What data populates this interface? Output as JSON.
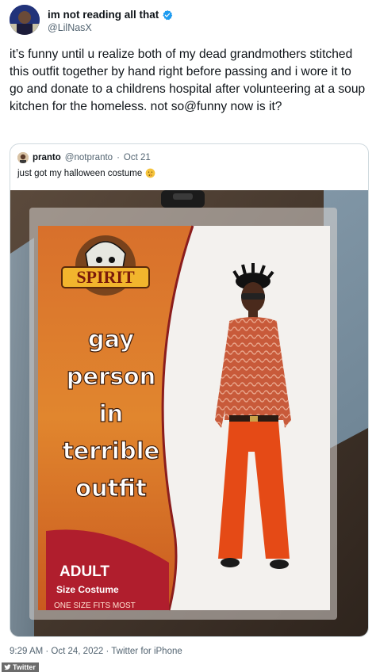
{
  "tweet": {
    "display_name": "im not reading all that",
    "handle": "@LilNasX",
    "text": "it’s funny until u realize both of my dead grandmothers stitched this outfit together by hand right before passing and i wore it to go and donate to a childrens hospital after volunteering at a soup kitchen for the homeless. not so@funny now is it?",
    "footer": "9:29 AM · Oct 24, 2022 · Twitter for iPhone",
    "verified_color": "#1d9bf0"
  },
  "quote": {
    "display_name": "pranto",
    "handle": "@notpranto",
    "separator": "·",
    "date": "Oct 21",
    "text": "just got my halloween costume",
    "emoji": "shushing-face-emoji"
  },
  "package": {
    "logo_text": "SPIRIT",
    "title_lines": [
      "gay",
      "person",
      "in",
      "terrible",
      "outfit"
    ],
    "adult": "ADULT",
    "size_costume": "Size Costume",
    "one_size": "ONE SIZE FITS MOST"
  },
  "watermark": "Twitter"
}
